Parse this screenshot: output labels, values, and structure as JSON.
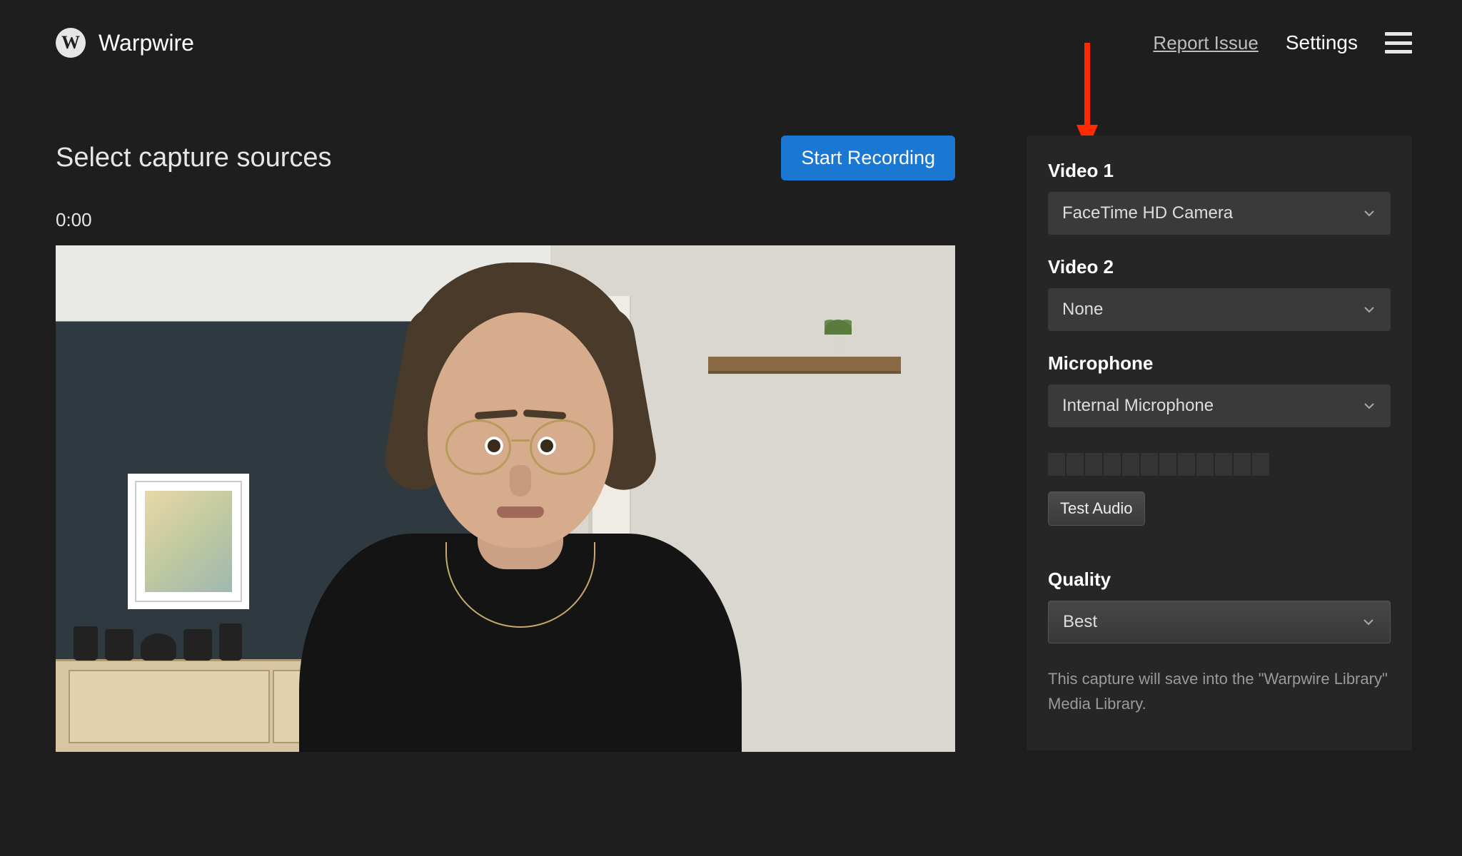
{
  "header": {
    "brand_letter": "W",
    "brand_name": "Warpwire",
    "report_link": "Report Issue",
    "settings_link": "Settings"
  },
  "main": {
    "title": "Select capture sources",
    "start_button": "Start Recording",
    "timer": "0:00"
  },
  "panel": {
    "video1": {
      "label": "Video 1",
      "value": "FaceTime HD Camera"
    },
    "video2": {
      "label": "Video 2",
      "value": "None"
    },
    "microphone": {
      "label": "Microphone",
      "value": "Internal Microphone"
    },
    "test_audio": "Test Audio",
    "quality": {
      "label": "Quality",
      "value": "Best"
    },
    "hint": "This capture will save into the \"Warpwire Library\" Media Library."
  },
  "colors": {
    "accent": "#1a77d2",
    "arrow": "#ff2a00"
  }
}
